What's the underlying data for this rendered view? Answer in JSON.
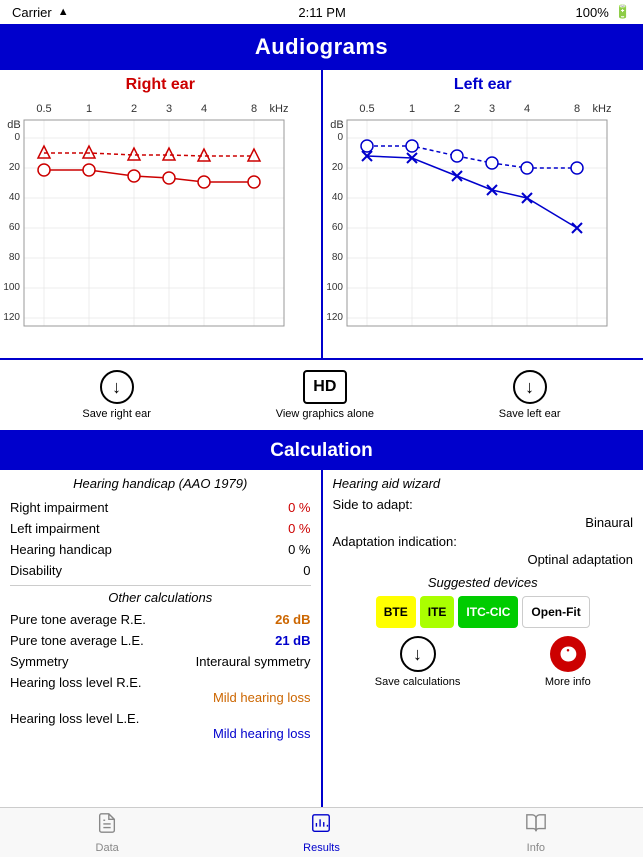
{
  "statusBar": {
    "carrier": "Carrier",
    "time": "2:11 PM",
    "battery": "100%"
  },
  "header": {
    "title": "Audiograms"
  },
  "charts": {
    "rightEar": {
      "title": "Right ear",
      "freqLabels": [
        "0.5",
        "1",
        "2",
        "3",
        "4",
        "8",
        "kHz"
      ],
      "dbLabel": "dB"
    },
    "leftEar": {
      "title": "Left ear",
      "freqLabels": [
        "0.5",
        "1",
        "2",
        "3",
        "4",
        "8",
        "kHz"
      ],
      "dbLabel": "dB"
    }
  },
  "actions": {
    "saveRight": "Save right ear",
    "viewGraphics": "View graphics alone",
    "saveLeft": "Save left ear",
    "hdLabel": "HD"
  },
  "calculation": {
    "sectionTitle": "Calculation",
    "leftPanel": {
      "subTitle": "Hearing handicap (AAO 1979)",
      "rows": [
        {
          "label": "Right impairment",
          "value": "0 %",
          "color": "red"
        },
        {
          "label": "Left impairment",
          "value": "0 %",
          "color": "red"
        },
        {
          "label": "Hearing handicap",
          "value": "0 %",
          "color": "black"
        },
        {
          "label": "Disability",
          "value": "0",
          "color": "black"
        }
      ],
      "otherTitle": "Other calculations",
      "otherRows": [
        {
          "label": "Pure tone average R.E.",
          "value": "26 dB",
          "color": "orange"
        },
        {
          "label": "Pure tone average L.E.",
          "value": "21 dB",
          "color": "blue"
        },
        {
          "label": "Symmetry",
          "value": "Interaural symmetry",
          "color": "black"
        }
      ],
      "hearingLossRE": {
        "label": "Hearing loss level R.E.",
        "value": "Mild hearing loss",
        "color": "orange"
      },
      "hearingLossLE": {
        "label": "Hearing loss level L.E.",
        "value": "Mild hearing loss",
        "color": "blue"
      }
    },
    "rightPanel": {
      "wizardTitle": "Hearing aid wizard",
      "sideToAdapt": "Side to adapt:",
      "sideValue": "Binaural",
      "adaptationLabel": "Adaptation indication:",
      "adaptationValue": "Optinal adaptation",
      "suggestedTitle": "Suggested devices",
      "devices": [
        {
          "label": "BTE",
          "color": "yellow"
        },
        {
          "label": "ITE",
          "color": "green-light"
        },
        {
          "label": "ITC-CIC",
          "color": "green-dark"
        },
        {
          "label": "Open-Fit",
          "color": "white"
        }
      ],
      "saveLabel": "Save calculations",
      "moreInfoLabel": "More info"
    }
  },
  "tabs": [
    {
      "label": "Data",
      "active": false
    },
    {
      "label": "Results",
      "active": true
    },
    {
      "label": "Info",
      "active": false
    }
  ]
}
